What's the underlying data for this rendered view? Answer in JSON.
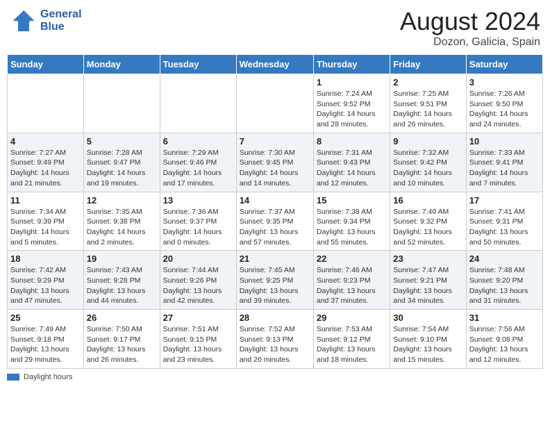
{
  "header": {
    "logo_general": "General",
    "logo_blue": "Blue",
    "month_year": "August 2024",
    "location": "Dozon, Galicia, Spain"
  },
  "days_of_week": [
    "Sunday",
    "Monday",
    "Tuesday",
    "Wednesday",
    "Thursday",
    "Friday",
    "Saturday"
  ],
  "footer": {
    "daylight_label": "Daylight hours"
  },
  "weeks": [
    [
      {
        "day": "",
        "info": ""
      },
      {
        "day": "",
        "info": ""
      },
      {
        "day": "",
        "info": ""
      },
      {
        "day": "",
        "info": ""
      },
      {
        "day": "1",
        "info": "Sunrise: 7:24 AM\nSunset: 9:52 PM\nDaylight: 14 hours\nand 28 minutes."
      },
      {
        "day": "2",
        "info": "Sunrise: 7:25 AM\nSunset: 9:51 PM\nDaylight: 14 hours\nand 26 minutes."
      },
      {
        "day": "3",
        "info": "Sunrise: 7:26 AM\nSunset: 9:50 PM\nDaylight: 14 hours\nand 24 minutes."
      }
    ],
    [
      {
        "day": "4",
        "info": "Sunrise: 7:27 AM\nSunset: 9:49 PM\nDaylight: 14 hours\nand 21 minutes."
      },
      {
        "day": "5",
        "info": "Sunrise: 7:28 AM\nSunset: 9:47 PM\nDaylight: 14 hours\nand 19 minutes."
      },
      {
        "day": "6",
        "info": "Sunrise: 7:29 AM\nSunset: 9:46 PM\nDaylight: 14 hours\nand 17 minutes."
      },
      {
        "day": "7",
        "info": "Sunrise: 7:30 AM\nSunset: 9:45 PM\nDaylight: 14 hours\nand 14 minutes."
      },
      {
        "day": "8",
        "info": "Sunrise: 7:31 AM\nSunset: 9:43 PM\nDaylight: 14 hours\nand 12 minutes."
      },
      {
        "day": "9",
        "info": "Sunrise: 7:32 AM\nSunset: 9:42 PM\nDaylight: 14 hours\nand 10 minutes."
      },
      {
        "day": "10",
        "info": "Sunrise: 7:33 AM\nSunset: 9:41 PM\nDaylight: 14 hours\nand 7 minutes."
      }
    ],
    [
      {
        "day": "11",
        "info": "Sunrise: 7:34 AM\nSunset: 9:39 PM\nDaylight: 14 hours\nand 5 minutes."
      },
      {
        "day": "12",
        "info": "Sunrise: 7:35 AM\nSunset: 9:38 PM\nDaylight: 14 hours\nand 2 minutes."
      },
      {
        "day": "13",
        "info": "Sunrise: 7:36 AM\nSunset: 9:37 PM\nDaylight: 14 hours\nand 0 minutes."
      },
      {
        "day": "14",
        "info": "Sunrise: 7:37 AM\nSunset: 9:35 PM\nDaylight: 13 hours\nand 57 minutes."
      },
      {
        "day": "15",
        "info": "Sunrise: 7:38 AM\nSunset: 9:34 PM\nDaylight: 13 hours\nand 55 minutes."
      },
      {
        "day": "16",
        "info": "Sunrise: 7:40 AM\nSunset: 9:32 PM\nDaylight: 13 hours\nand 52 minutes."
      },
      {
        "day": "17",
        "info": "Sunrise: 7:41 AM\nSunset: 9:31 PM\nDaylight: 13 hours\nand 50 minutes."
      }
    ],
    [
      {
        "day": "18",
        "info": "Sunrise: 7:42 AM\nSunset: 9:29 PM\nDaylight: 13 hours\nand 47 minutes."
      },
      {
        "day": "19",
        "info": "Sunrise: 7:43 AM\nSunset: 9:28 PM\nDaylight: 13 hours\nand 44 minutes."
      },
      {
        "day": "20",
        "info": "Sunrise: 7:44 AM\nSunset: 9:26 PM\nDaylight: 13 hours\nand 42 minutes."
      },
      {
        "day": "21",
        "info": "Sunrise: 7:45 AM\nSunset: 9:25 PM\nDaylight: 13 hours\nand 39 minutes."
      },
      {
        "day": "22",
        "info": "Sunrise: 7:46 AM\nSunset: 9:23 PM\nDaylight: 13 hours\nand 37 minutes."
      },
      {
        "day": "23",
        "info": "Sunrise: 7:47 AM\nSunset: 9:21 PM\nDaylight: 13 hours\nand 34 minutes."
      },
      {
        "day": "24",
        "info": "Sunrise: 7:48 AM\nSunset: 9:20 PM\nDaylight: 13 hours\nand 31 minutes."
      }
    ],
    [
      {
        "day": "25",
        "info": "Sunrise: 7:49 AM\nSunset: 9:18 PM\nDaylight: 13 hours\nand 29 minutes."
      },
      {
        "day": "26",
        "info": "Sunrise: 7:50 AM\nSunset: 9:17 PM\nDaylight: 13 hours\nand 26 minutes."
      },
      {
        "day": "27",
        "info": "Sunrise: 7:51 AM\nSunset: 9:15 PM\nDaylight: 13 hours\nand 23 minutes."
      },
      {
        "day": "28",
        "info": "Sunrise: 7:52 AM\nSunset: 9:13 PM\nDaylight: 13 hours\nand 20 minutes."
      },
      {
        "day": "29",
        "info": "Sunrise: 7:53 AM\nSunset: 9:12 PM\nDaylight: 13 hours\nand 18 minutes."
      },
      {
        "day": "30",
        "info": "Sunrise: 7:54 AM\nSunset: 9:10 PM\nDaylight: 13 hours\nand 15 minutes."
      },
      {
        "day": "31",
        "info": "Sunrise: 7:56 AM\nSunset: 9:08 PM\nDaylight: 13 hours\nand 12 minutes."
      }
    ]
  ]
}
